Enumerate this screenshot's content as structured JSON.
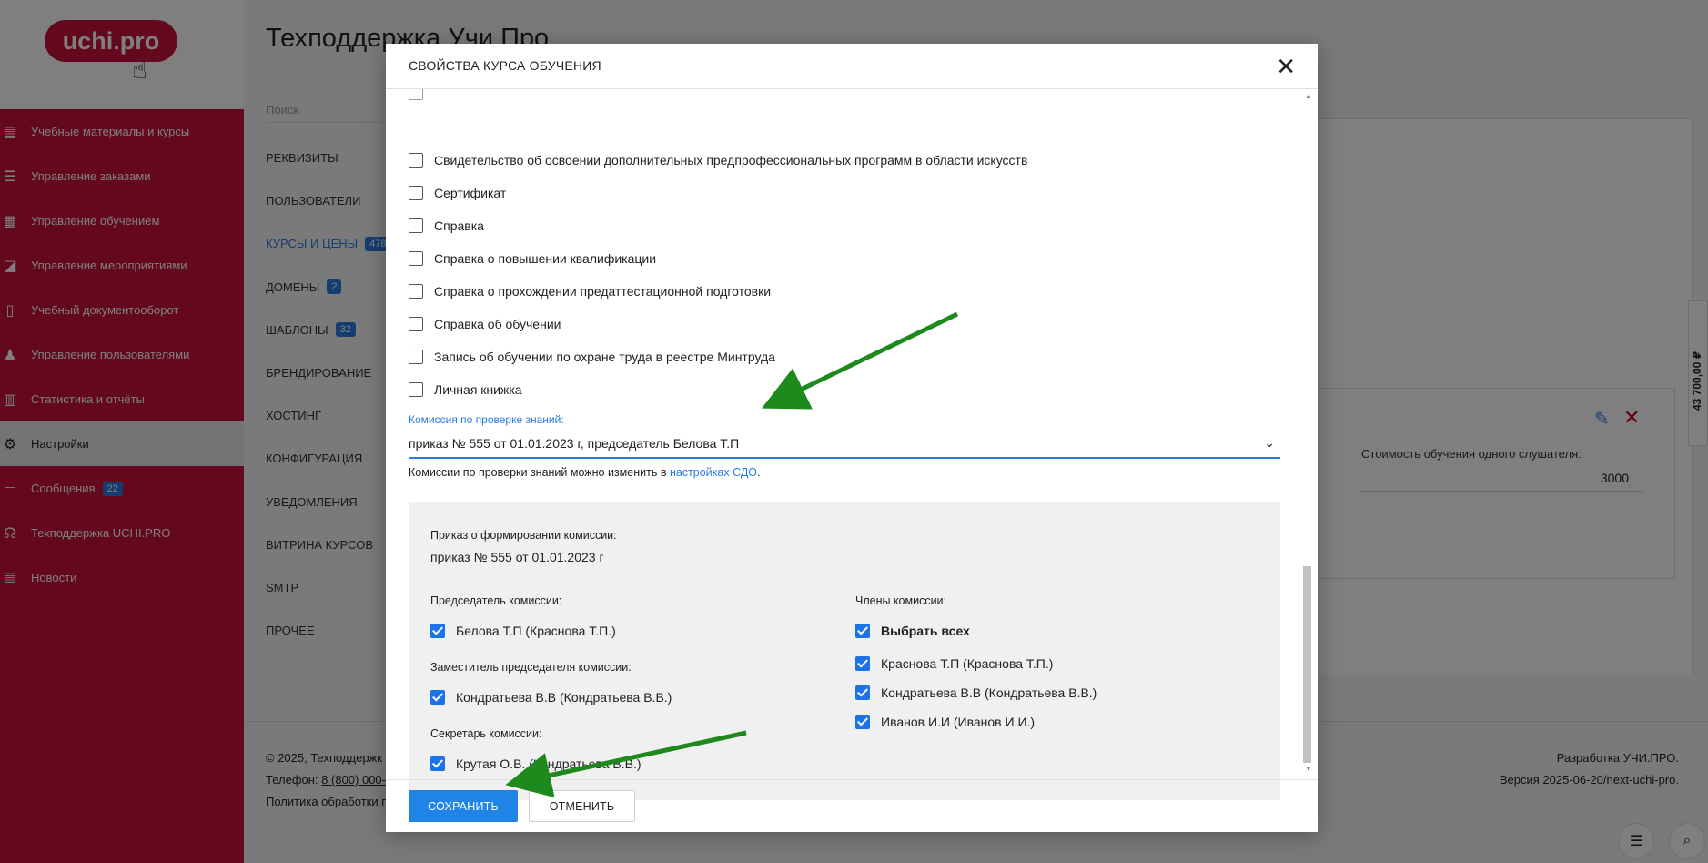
{
  "logo": {
    "text": "uchi.pro"
  },
  "sidebar": {
    "items": [
      {
        "label": "Учебные материалы и курсы",
        "icon": "book-icon"
      },
      {
        "label": "Управление заказами",
        "icon": "list-icon"
      },
      {
        "label": "Управление обучением",
        "icon": "clipboard-icon"
      },
      {
        "label": "Управление мероприятиями",
        "icon": "broadcast-icon"
      },
      {
        "label": "Учебный документооборот",
        "icon": "document-icon"
      },
      {
        "label": "Управление пользователями",
        "icon": "users-icon"
      },
      {
        "label": "Статистика и отчёты",
        "icon": "chart-icon"
      },
      {
        "label": "Настройки",
        "icon": "gear-icon"
      },
      {
        "label": "Сообщения",
        "icon": "message-icon",
        "badge": "22"
      },
      {
        "label": "Техподдержка UCHI.PRO",
        "icon": "support-icon"
      },
      {
        "label": "Новости",
        "icon": "news-icon"
      }
    ]
  },
  "main": {
    "title": "Техподдержка Учи Про",
    "search_placeholder": "Поиск",
    "subnav": [
      {
        "label": "РЕКВИЗИТЫ"
      },
      {
        "label": "ПОЛЬЗОВАТЕЛИ"
      },
      {
        "label": "КУРСЫ И ЦЕНЫ",
        "badge": "478"
      },
      {
        "label": "ДОМЕНЫ",
        "badge": "2"
      },
      {
        "label": "ШАБЛОНЫ",
        "badge": "32"
      },
      {
        "label": "БРЕНДИРОВАНИЕ"
      },
      {
        "label": "ХОСТИНГ"
      },
      {
        "label": "КОНФИГУРАЦИЯ"
      },
      {
        "label": "УВЕДОМЛЕНИЯ"
      },
      {
        "label": "ВИТРИНА КУРСОВ"
      },
      {
        "label": "SMTP"
      },
      {
        "label": "ПРОЧЕЕ"
      }
    ],
    "cost_label": "Стоимость обучения одного слушателя:",
    "cost_value": "3000",
    "side_price": "43 700,00 ₽"
  },
  "footer": {
    "copyright": "©  2025, Техподдержк",
    "phone_label": "Телефон:",
    "phone": "8 (800) 000-0",
    "policy": "Политика обработки п",
    "dev": "Разработка УЧИ.ПРО.",
    "version": "Версия 2025-06-20/next-uchi-pro."
  },
  "modal": {
    "title": "СВОЙСТВА КУРСА ОБУЧЕНИЯ",
    "checkboxes": [
      {
        "label": "Свидетельство об освоении дополнительных предпрофессиональных программ в области искусств",
        "checked": false
      },
      {
        "label": "Сертификат",
        "checked": false
      },
      {
        "label": "Справка",
        "checked": false
      },
      {
        "label": "Справка о повышении квалификации",
        "checked": false
      },
      {
        "label": "Справка о прохождении предаттестационной подготовки",
        "checked": false
      },
      {
        "label": "Справка об обучении",
        "checked": false
      },
      {
        "label": "Запись об обучении по охране труда в реестре Минтруда",
        "checked": false
      },
      {
        "label": "Личная книжка",
        "checked": false
      }
    ],
    "commission_label": "Комиссия по проверке знаний:",
    "commission_value": "приказ № 555 от 01.01.2023 г, председатель Белова Т.П",
    "hint_text": "Комиссии по проверки знаний можно изменить в ",
    "hint_link": "настройках СДО",
    "hint_end": ".",
    "order_label": "Приказ о формировании комиссии:",
    "order_value": "приказ № 555 от 01.01.2023 г",
    "chair_label": "Председатель комиссии:",
    "chair": "Белова Т.П (Краснова Т.П.)",
    "deputy_label": "Заместитель председателя комиссии:",
    "deputy": "Кондратьева В.В (Кондратьева В.В.)",
    "secretary_label": "Секретарь комиссии:",
    "secretary": "Крутая О.В. (Кондратьева В.В.)",
    "members_label": "Члены комиссии:",
    "select_all": "Выбрать всех",
    "members": [
      "Краснова Т.П (Краснова Т.П.)",
      "Кондратьева В.В (Кондратьева В.В.)",
      "Иванов И.И (Иванов И.И.)"
    ],
    "save_label": "СОХРАНИТЬ",
    "cancel_label": "ОТМЕНИТЬ"
  },
  "colors": {
    "brand": "#c8103a",
    "accent": "#1f84e6",
    "arrow": "#1e8a1e"
  }
}
